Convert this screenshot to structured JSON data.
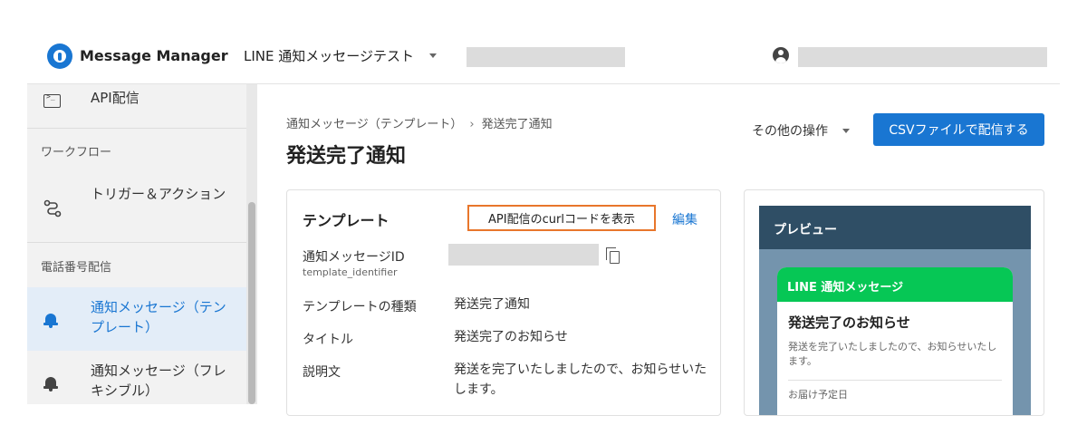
{
  "header": {
    "brand": "Message Manager",
    "project": "LINE 通知メッセージテスト"
  },
  "sidebar": {
    "items": [
      {
        "label": "API配信",
        "icon": "terminal-icon"
      },
      {
        "section": "ワークフロー"
      },
      {
        "label": "トリガー＆アクション",
        "icon": "workflow-icon"
      },
      {
        "section": "電話番号配信"
      },
      {
        "label": "通知メッセージ（テンプレート）",
        "icon": "bell-icon",
        "active": true
      },
      {
        "label": "通知メッセージ（フレキシブル）",
        "icon": "bell-icon"
      }
    ]
  },
  "main": {
    "breadcrumb": {
      "parent": "通知メッセージ（テンプレート）",
      "separator": "›",
      "current": "発送完了通知"
    },
    "title": "発送完了通知",
    "more_ops": "その他の操作",
    "csv_button": "CSVファイルで配信する"
  },
  "template": {
    "title": "テンプレート",
    "curl_button": "API配信のcurlコードを表示",
    "edit": "編集",
    "fields": {
      "id_label": "通知メッセージID",
      "id_sub": "template_identifier",
      "type_label": "テンプレートの種類",
      "type_value": "発送完了通知",
      "title_label": "タイトル",
      "title_value": "発送完了のお知らせ",
      "desc_label": "説明文",
      "desc_value": "発送を完了いたしましたので、お知らせいたします。"
    }
  },
  "preview": {
    "header": "プレビュー",
    "bubble_header": "LINE 通知メッセージ",
    "bubble_title": "発送完了のお知らせ",
    "bubble_body": "発送を完了いたしましたので、お知らせいたします。",
    "bubble_date_label": "お届け予定日"
  },
  "colors": {
    "accent": "#1976d2",
    "highlight_border": "#e8762b",
    "line_green": "#06c755",
    "preview_header": "#2f4e65",
    "preview_bg": "#7494ad"
  }
}
